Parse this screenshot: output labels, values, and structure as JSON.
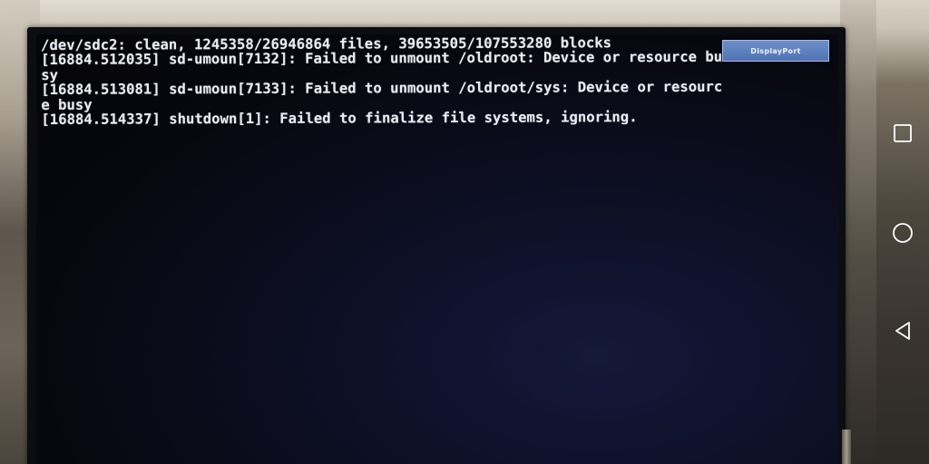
{
  "terminal": {
    "lines": [
      "/dev/sdc2: clean, 1245358/26946864 files, 39653505/107553280 blocks",
      "[16884.512035] sd-umoun[7132]: Failed to unmount /oldroot: Device or resource bu",
      "sy",
      "[16884.513081] sd-umoun[7133]: Failed to unmount /oldroot/sys: Device or resourc",
      "e busy",
      "[16884.514337] shutdown[1]: Failed to finalize file systems, ignoring."
    ]
  },
  "osd": {
    "label": "DisplayPort"
  },
  "navigation_bar": {
    "buttons": [
      {
        "icon": "square-recents-icon"
      },
      {
        "icon": "circle-home-icon"
      },
      {
        "icon": "triangle-back-icon"
      }
    ]
  },
  "colors": {
    "terminal_text": "#e9ebf2",
    "screen_background": "#07080f",
    "osd_background": "#4f73b4",
    "nav_icon": "#ffffff"
  }
}
